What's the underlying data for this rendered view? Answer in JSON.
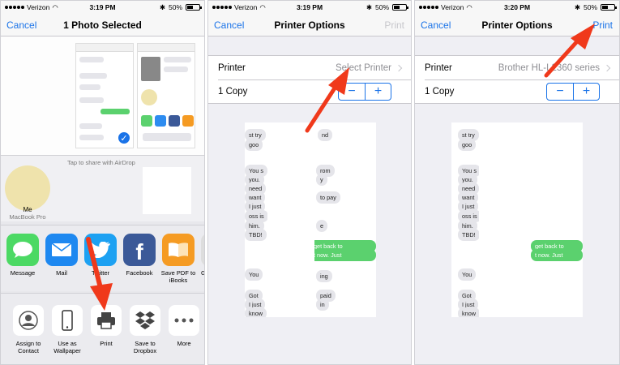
{
  "status": {
    "carrier": "Verizon",
    "battery": "50%",
    "times": [
      "3:19 PM",
      "3:19 PM",
      "3:20 PM"
    ]
  },
  "share_sheet": {
    "cancel": "Cancel",
    "title": "1 Photo Selected",
    "airdrop_hint": "Tap to share with AirDrop",
    "contact_name": "Me",
    "contact_device": "MacBook Pro",
    "apps": [
      {
        "label": "Message",
        "icon": "messages-icon"
      },
      {
        "label": "Mail",
        "icon": "mail-icon"
      },
      {
        "label": "Twitter",
        "icon": "twitter-icon"
      },
      {
        "label": "Facebook",
        "icon": "facebook-icon"
      },
      {
        "label": "Save PDF to iBooks",
        "icon": "ibooks-icon"
      },
      {
        "label": "Go",
        "icon": "more-apps-icon"
      }
    ],
    "actions": [
      {
        "label": "Assign to Contact",
        "icon": "contact-icon"
      },
      {
        "label": "Use as Wallpaper",
        "icon": "phone-icon"
      },
      {
        "label": "Print",
        "icon": "printer-icon"
      },
      {
        "label": "Save to Dropbox",
        "icon": "dropbox-icon"
      },
      {
        "label": "More",
        "icon": "more-icon"
      }
    ]
  },
  "printer_options_1": {
    "cancel": "Cancel",
    "title": "Printer Options",
    "print": "Print",
    "printer_label": "Printer",
    "printer_value": "Select Printer",
    "copies": "1 Copy",
    "minus": "−",
    "plus": "+"
  },
  "printer_options_2": {
    "cancel": "Cancel",
    "title": "Printer Options",
    "print": "Print",
    "printer_label": "Printer",
    "printer_value": "Brother HL-L2360 series",
    "copies": "1 Copy",
    "minus": "−",
    "plus": "+"
  },
  "messages": {
    "left_col": [
      "st try",
      "goo",
      "You s",
      "you.",
      "need",
      "want",
      "I just",
      "oss is",
      "him. ",
      "TBD!",
      "You",
      "Got",
      "I just",
      "know"
    ],
    "right_col": [
      "nd",
      "rom",
      "y",
      "to pay",
      "e",
      "get back to",
      "t now. Just",
      "ing",
      "paid",
      "in"
    ]
  },
  "colors": {
    "ios_blue": "#1a73e8",
    "arrow_red": "#f0391b",
    "imessage_green": "#5bd16e"
  }
}
